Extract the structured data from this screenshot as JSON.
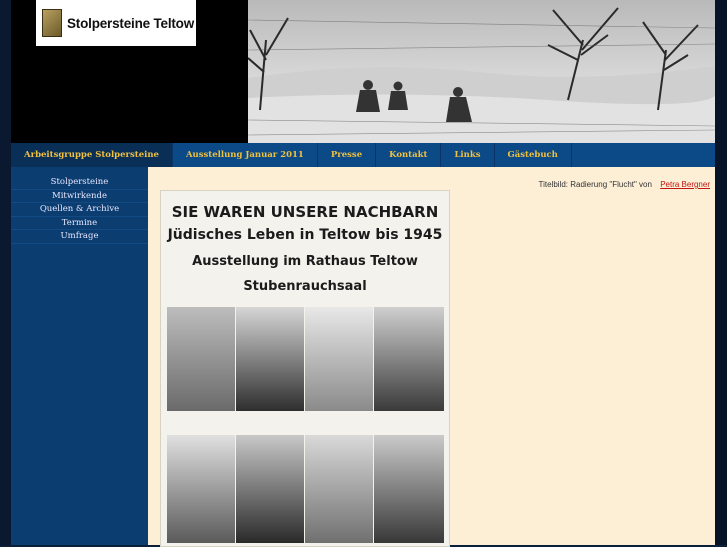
{
  "logo": {
    "text": "Stolpersteine Teltow",
    "icon": "logo-stone-icon"
  },
  "nav": [
    {
      "label": "Arbeitsgruppe Stolpersteine",
      "active": true
    },
    {
      "label": "Ausstellung Januar 2011",
      "active": false
    },
    {
      "label": "Presse",
      "active": false
    },
    {
      "label": "Kontakt",
      "active": false
    },
    {
      "label": "Links",
      "active": false
    },
    {
      "label": "Gästebuch",
      "active": false
    }
  ],
  "sidebar": [
    {
      "label": "Stolpersteine"
    },
    {
      "label": "Mitwirkende"
    },
    {
      "label": "Quellen & Archive"
    },
    {
      "label": "Termine"
    },
    {
      "label": "Umfrage"
    }
  ],
  "caption": {
    "text": "Titelbild: Radierung \"Flucht\" von",
    "link": "Petra Bergner"
  },
  "poster": {
    "line1": "SIE WAREN UNSERE NACHBARN",
    "line2": "Jüdisches Leben in Teltow bis 1945",
    "line3": "Ausstellung im Rathaus Teltow",
    "line4": "Stubenrauchsaal"
  },
  "colors": {
    "nav_bg": "#0b4a86",
    "nav_text": "#f0c040",
    "content_bg": "#fcefd6",
    "link": "#c0140f"
  }
}
